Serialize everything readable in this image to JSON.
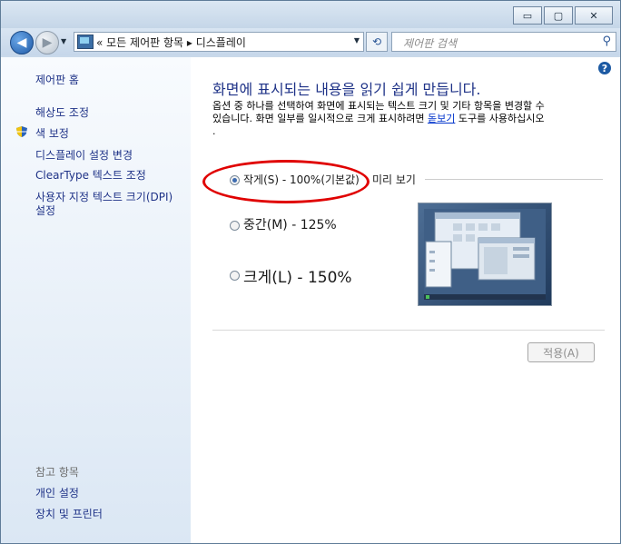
{
  "window": {
    "minimize": "▭",
    "maximize": "▢",
    "close": "✕"
  },
  "navbar": {
    "address_text": "« 모든 제어판 항목 ▸ 디스플레이",
    "search_placeholder": "제어판 검색"
  },
  "sidebar": {
    "home": "제어판 홈",
    "items": [
      "해상도 조정",
      "색 보정",
      "디스플레이 설정 변경",
      "ClearType 텍스트 조정",
      "사용자 지정 텍스트 크기(DPI)",
      "설정"
    ],
    "see_also": "참고 항목",
    "see_also_items": [
      "개인 설정",
      "장치 및 프린터"
    ]
  },
  "main": {
    "heading": "화면에 표시되는 내용을 읽기 쉽게 만듭니다.",
    "desc_line1": "옵션 중 하나를 선택하여 화면에 표시되는 텍스트 크기 및 기타 항목을 변경할 수",
    "desc_line2_prefix": "있습니다. 화면 일부를 일시적으로 크게 표시하려면 ",
    "desc_link": "돋보기",
    "desc_line2_suffix": " 도구를 사용하십시오",
    "desc_line3": ".",
    "options": [
      {
        "label": "작게(S) - 100%(기본값)",
        "selected": true
      },
      {
        "label": "중간(M) - 125%",
        "selected": false
      },
      {
        "label": "크게(L) - 150%",
        "selected": false
      }
    ],
    "preview_label": "미리 보기",
    "apply_label": "적용(A)"
  },
  "colors": {
    "link": "#1e3287",
    "annotation": "#e00000"
  }
}
